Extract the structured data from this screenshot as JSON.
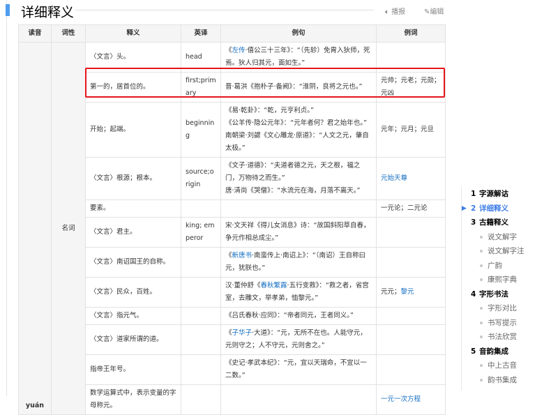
{
  "section": {
    "title": "详细释义",
    "broadcast": "播报",
    "edit": "编辑"
  },
  "table": {
    "headers": [
      "读音",
      "词性",
      "释义",
      "英译",
      "例句",
      "例词"
    ],
    "pronunciation": "yuán",
    "pos": "名词",
    "rows": [
      {
        "def": "〈文言〉头。",
        "en": "head",
        "ex": [
          [
            {
              "t": "《"
            },
            {
              "t": "左传",
              "link": true
            },
            {
              "t": "·僖公三十三年》：“（先轸）免胄入狄师，死焉。狄人归其元，面如生。”"
            }
          ]
        ],
        "words": []
      },
      {
        "def": "第一的，居首位的。",
        "en": "first;primary",
        "ex": [
          [
            {
              "t": "晋·葛洪《抱朴子·备阙》：“淮阴，良将之元也。”"
            }
          ]
        ],
        "words": [
          {
            "t": "元帅；元老；元勋；元凶"
          }
        ]
      },
      {
        "def": "开始；起端。",
        "en": "beginning",
        "ex": [
          [
            {
              "t": "《易·乾卦》：“乾，元亨利贞。”"
            }
          ],
          [
            {
              "t": "《公羊传·隐公元年》：“元年者何？君之始年也。”"
            }
          ],
          [
            {
              "t": "南朝梁·刘勰《文心雕龙·原道》：“人文之元，肇自太极。”"
            }
          ]
        ],
        "words": [
          {
            "t": "元年；元月；元旦"
          }
        ]
      },
      {
        "def": "〈文言〉根源；根本。",
        "en": "source;origin",
        "ex": [
          [
            {
              "t": "《文子·道德》：“夫道者德之元，天之根，福之门，万物待之而生。”"
            }
          ],
          [
            {
              "t": "唐·清尚《哭僧》：“水流元在海，月落不离天。”"
            }
          ]
        ],
        "words": [
          {
            "t": "元始天尊",
            "link": true
          }
        ]
      },
      {
        "def": "要素。",
        "en": "",
        "ex": [],
        "words": [
          {
            "t": "一元论；二元论"
          }
        ]
      },
      {
        "def": "〈文言〉君主。",
        "en": "king; emperor",
        "ex": [
          [
            {
              "t": "宋·文天祥《得儿女消息》诗：“故国斜阳草自春，争元作相总成尘。”"
            }
          ]
        ],
        "words": []
      },
      {
        "def": "〈文言〉南诏国王的自称。",
        "en": "",
        "ex": [
          [
            {
              "t": "《"
            },
            {
              "t": "新唐书",
              "link": true
            },
            {
              "t": "·南蛮传上·南诏上》：“（南诏）王自称曰元，犹朕也。”"
            }
          ]
        ],
        "words": []
      },
      {
        "def": "〈文言〉民众，百姓。",
        "en": "",
        "ex": [
          [
            {
              "t": "汉·董仲舒《"
            },
            {
              "t": "春秋繁露",
              "link": true
            },
            {
              "t": "·五行变救》：“救之者，省宫室，去雕文，举孝弟，恤黎元。”"
            }
          ]
        ],
        "words": [
          {
            "t": "元元；"
          },
          {
            "t": "黎元",
            "link": true
          }
        ]
      },
      {
        "def": "〈文言〉指元气。",
        "en": "",
        "ex": [
          [
            {
              "t": "《吕氏春秋·应同》：“帝者同元，王者同义。”"
            }
          ]
        ],
        "words": []
      },
      {
        "def": "〈文言〉道家所谓的道。",
        "en": "",
        "ex": [
          [
            {
              "t": "《"
            },
            {
              "t": "子华子",
              "link": true
            },
            {
              "t": "·大道》：“元，无所不在也。人能守元，元则守之；人不守元，元则舍之。”"
            }
          ]
        ],
        "words": []
      },
      {
        "def": "指帝王年号。",
        "en": "",
        "ex": [
          [
            {
              "t": "《史记·孝武本纪》：“元，宜以天瑞命，不宜以一二数。”"
            }
          ]
        ],
        "words": []
      },
      {
        "def": "数学运算式中，表示变量的字母称元。",
        "en": "",
        "ex": [],
        "words": [
          {
            "t": "一元一次方程",
            "link": true
          }
        ]
      }
    ]
  },
  "toc": [
    {
      "num": "1",
      "label": "字源解诂",
      "level": 1
    },
    {
      "num": "2",
      "label": "详细释义",
      "level": 1,
      "active": true
    },
    {
      "num": "3",
      "label": "古籍释义",
      "level": 1
    },
    {
      "label": "说文解字",
      "level": 2
    },
    {
      "label": "说文解字注",
      "level": 2
    },
    {
      "label": "广韵",
      "level": 2
    },
    {
      "label": "康熙字典",
      "level": 2
    },
    {
      "num": "4",
      "label": "字形书法",
      "level": 1
    },
    {
      "label": "字形对比",
      "level": 2
    },
    {
      "label": "书写提示",
      "level": 2
    },
    {
      "label": "书法欣赏",
      "level": 2
    },
    {
      "num": "5",
      "label": "音韵集成",
      "level": 1
    },
    {
      "label": "中上古音",
      "level": 2
    },
    {
      "label": "韵书集成",
      "level": 2
    }
  ]
}
